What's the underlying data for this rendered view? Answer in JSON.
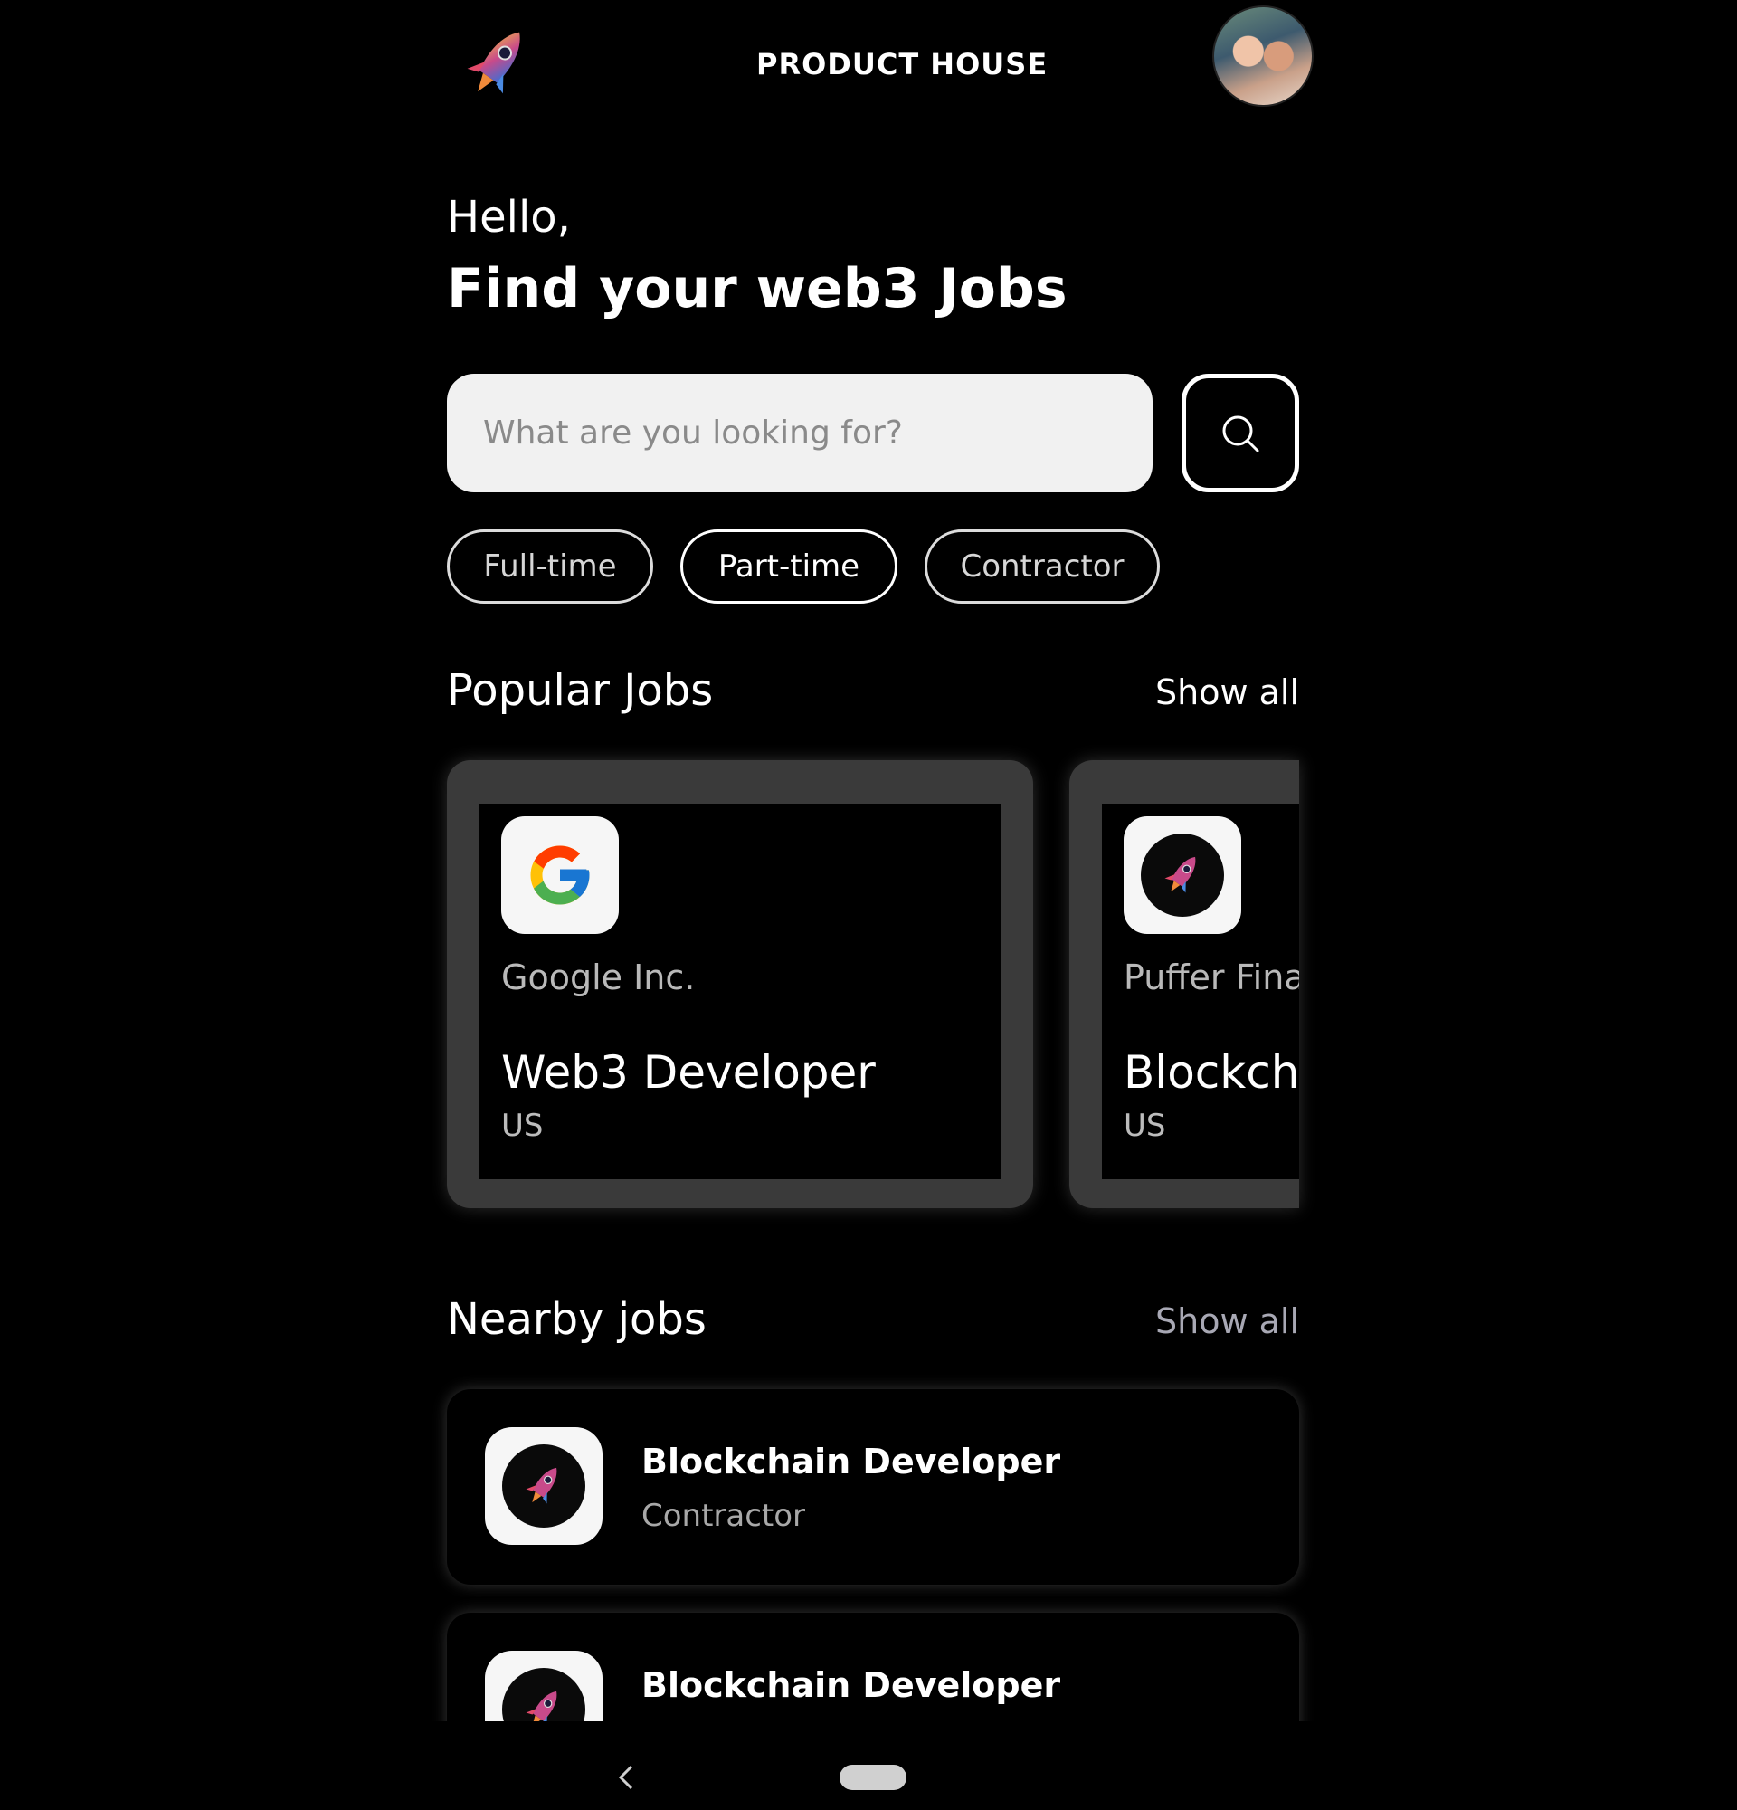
{
  "header": {
    "logo_icon": "rocket-icon",
    "brand": "PRODUCT HOUSE",
    "avatar_icon": "user-avatar"
  },
  "greeting": {
    "hello": "Hello,",
    "headline": "Find your web3 Jobs"
  },
  "search": {
    "placeholder": "What are you looking for?",
    "button_icon": "search-icon"
  },
  "filters": [
    {
      "label": "Full-time",
      "selected": false
    },
    {
      "label": "Part-time",
      "selected": true
    },
    {
      "label": "Contractor",
      "selected": false
    }
  ],
  "popular": {
    "title": "Popular Jobs",
    "show_all": "Show all",
    "cards": [
      {
        "company": "Google Inc.",
        "role": "Web3 Developer",
        "location": "US",
        "logo": "google-logo"
      },
      {
        "company": "Puffer Fina",
        "role": "Blockch",
        "location": "US",
        "logo": "rocket-logo"
      }
    ]
  },
  "nearby": {
    "title": "Nearby jobs",
    "show_all": "Show all",
    "items": [
      {
        "role": "Blockchain Developer",
        "type": "Contractor",
        "logo": "rocket-logo"
      },
      {
        "role": "Blockchain Developer",
        "type": "",
        "logo": "rocket-logo"
      }
    ]
  },
  "system_nav": {
    "back_icon": "back-chevron-icon",
    "home_icon": "home-pill-icon"
  },
  "colors": {
    "background": "#000000",
    "text": "#ffffff",
    "muted": "#b9b9b9",
    "card_frame": "#3a3a3a",
    "search_field": "#f1f1f1"
  }
}
